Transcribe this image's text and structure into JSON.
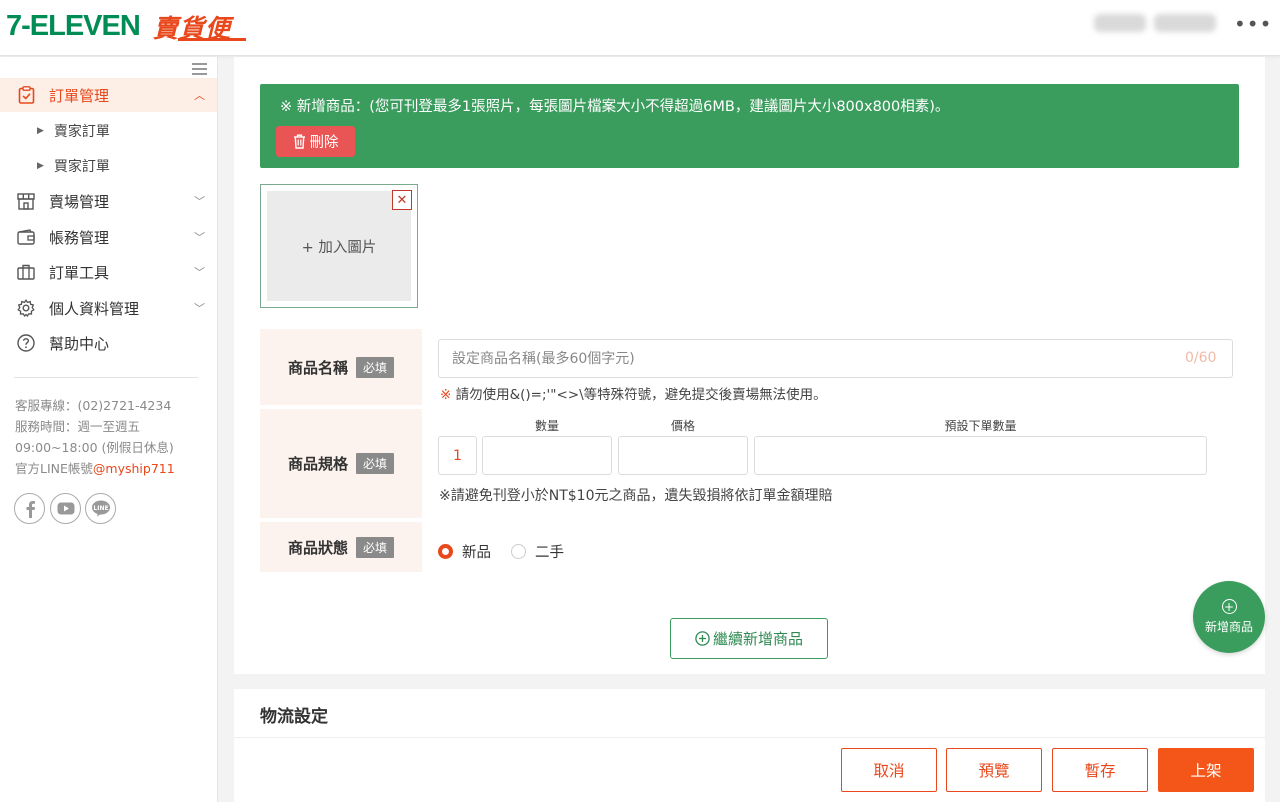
{
  "header": {
    "logo_711": "7-ELEVEN",
    "logo_brand": "賣貨便"
  },
  "sidebar": {
    "items": [
      {
        "label": "訂單管理",
        "icon": "clipboard-icon"
      },
      {
        "label": "賣場管理",
        "icon": "store-icon"
      },
      {
        "label": "帳務管理",
        "icon": "wallet-icon"
      },
      {
        "label": "訂單工具",
        "icon": "briefcase-icon"
      },
      {
        "label": "個人資料管理",
        "icon": "gear-icon"
      },
      {
        "label": "幫助中心",
        "icon": "help-icon"
      }
    ],
    "sub_items": [
      "賣家訂單",
      "買家訂單"
    ],
    "contact": {
      "hotline": "客服專線：(02)2721-4234",
      "hours": "服務時間：週一至週五",
      "time": "09:00~18:00 (例假日休息)",
      "line_prefix": "官方LINE帳號",
      "line_id": "@myship711"
    },
    "social": [
      "facebook-icon",
      "youtube-icon",
      "line-icon"
    ]
  },
  "notice": {
    "text": "※ 新增商品：(您可刊登最多1張照片，每張圖片檔案大小不得超過6MB，建議圖片大小800x800相素)。",
    "delete_label": "刪除"
  },
  "image_upload": {
    "add_label": "+ 加入圖片",
    "close_label": "✕"
  },
  "form": {
    "required_tag": "必填",
    "name_label": "商品名稱",
    "name_placeholder": "設定商品名稱(最多60個字元)",
    "name_counter": "0/60",
    "name_hint_mark": "※",
    "name_hint": "請勿使用&()=;'\"<>\\等特殊符號，避免提交後賣場無法使用。",
    "spec_label": "商品規格",
    "spec_headers": {
      "qty": "數量",
      "price": "價格",
      "default_qty": "預設下單數量"
    },
    "spec_index": "1",
    "spec_hint": "※請避免刊登小於NT$10元之商品，遺失毀損將依訂單金額理賠",
    "status_label": "商品狀態",
    "status_options": [
      "新品",
      "二手"
    ],
    "status_selected": "新品"
  },
  "continue_button": "繼續新增商品",
  "fab_label": "新增商品",
  "logistics": {
    "title": "物流設定",
    "buttons": {
      "cancel": "取消",
      "preview": "預覽",
      "draft": "暫存",
      "publish": "上架"
    }
  },
  "colors": {
    "brand_orange": "#e8481c",
    "brand_green": "#3a9d5d",
    "danger_red": "#e95454"
  }
}
